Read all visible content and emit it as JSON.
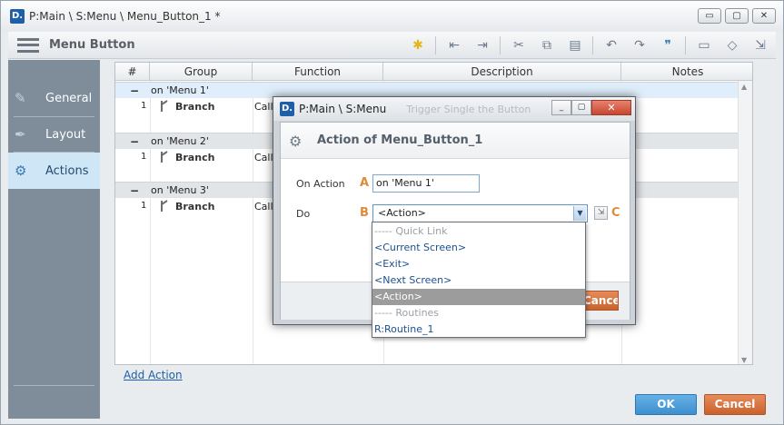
{
  "window": {
    "logo": "D.",
    "title": "P:Main \\ S:Menu \\ Menu_Button_1 *",
    "controls": {
      "minimize": "▭",
      "maximize": "▢",
      "close": "✕"
    }
  },
  "toolbar": {
    "title": "Menu Button",
    "icons": [
      "lightbulb-icon",
      "outdent-icon",
      "indent-icon",
      "cut-icon",
      "copy-icon",
      "paste-icon",
      "undo-icon",
      "redo-icon",
      "comment-icon",
      "note-icon",
      "tag-icon",
      "resize-icon"
    ]
  },
  "sidebar": {
    "items": [
      {
        "label": "General",
        "icon": "general-icon"
      },
      {
        "label": "Layout",
        "icon": "layout-icon"
      },
      {
        "label": "Actions",
        "icon": "actions-icon",
        "active": true
      }
    ]
  },
  "table": {
    "columns": [
      "#",
      "Group",
      "Function",
      "Description",
      "Notes"
    ],
    "groups": [
      {
        "label": "on 'Menu 1'",
        "rows": [
          {
            "num": "1",
            "group": "Branch",
            "function": "Call"
          }
        ]
      },
      {
        "label": "on 'Menu 2'",
        "rows": [
          {
            "num": "1",
            "group": "Branch",
            "function": "Call"
          }
        ]
      },
      {
        "label": "on 'Menu 3'",
        "rows": [
          {
            "num": "1",
            "group": "Branch",
            "function": "Call"
          }
        ]
      }
    ],
    "add_action": "Add Action"
  },
  "footer": {
    "ok": "OK",
    "cancel": "Cancel"
  },
  "dialog": {
    "logo": "D.",
    "title": "P:Main \\ S:Menu",
    "ghost_text": "Trigger Single the Button",
    "controls": {
      "minimize": "_",
      "maximize": "▢",
      "close": "✕"
    },
    "heading": "Action of Menu_Button_1",
    "on_action_label": "On Action",
    "on_action_marker": "A",
    "on_action_value": "on 'Menu 1'",
    "do_label": "Do",
    "do_marker": "B",
    "do_value": "<Action>",
    "c_marker": "C",
    "cancel": "Cancel"
  },
  "dropdown": {
    "options": [
      {
        "label": "----- Quick Link",
        "type": "header"
      },
      {
        "label": "<Current Screen>",
        "type": "item"
      },
      {
        "label": "<Exit>",
        "type": "item"
      },
      {
        "label": "<Next Screen>",
        "type": "item"
      },
      {
        "label": "<Action>",
        "type": "item",
        "selected": true
      },
      {
        "label": "----- Routines",
        "type": "header"
      },
      {
        "label": "R:Routine_1",
        "type": "item"
      }
    ]
  },
  "colors": {
    "sidebar": "#7f8d9b",
    "active_nav": "#cfe6f6",
    "ok_button": "#3d8fcf",
    "cancel_button": "#c9622d",
    "marker": "#e08a3a",
    "selected_option": "#9c9c9c"
  }
}
